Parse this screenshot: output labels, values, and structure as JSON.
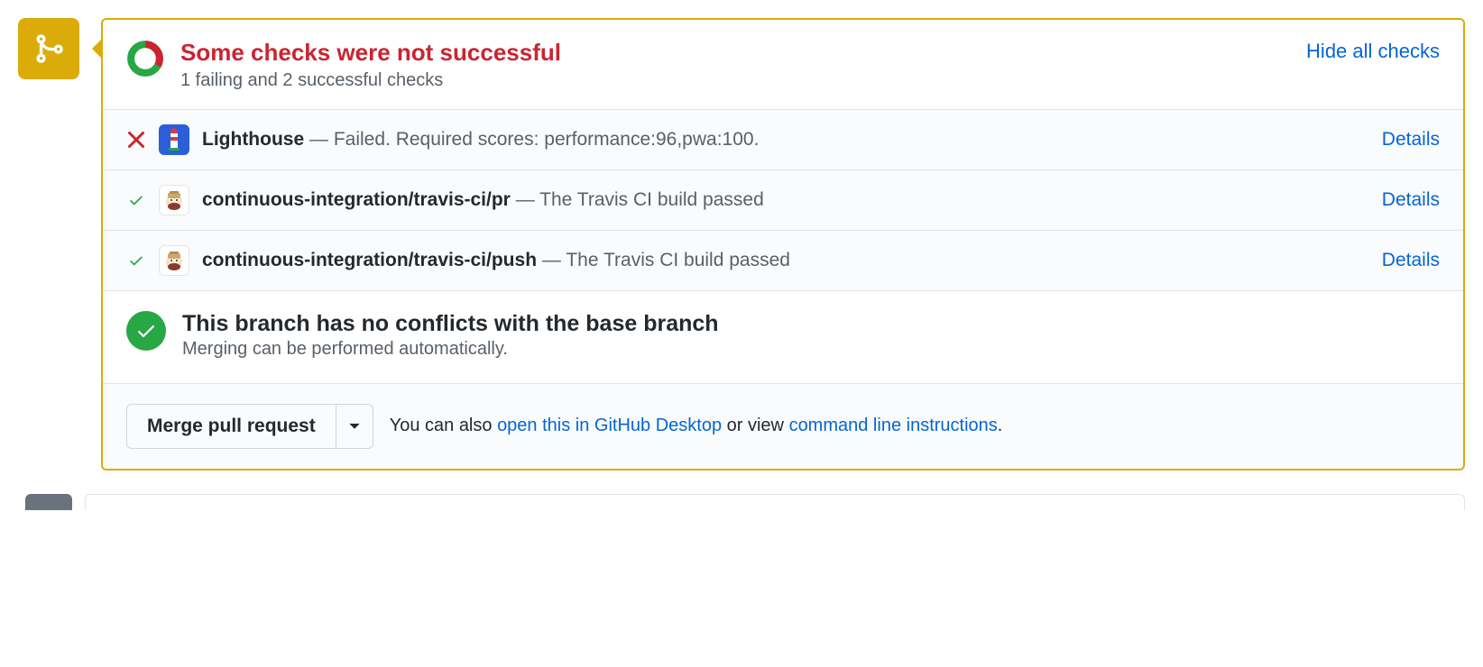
{
  "header": {
    "title": "Some checks were not successful",
    "subtitle": "1 failing and 2 successful checks",
    "hide_link": "Hide all checks"
  },
  "checks": [
    {
      "status": "fail",
      "avatar": "lighthouse",
      "name": "Lighthouse",
      "sep": " — ",
      "message": "Failed. Required scores: performance:96,pwa:100.",
      "details": "Details"
    },
    {
      "status": "pass",
      "avatar": "travis",
      "name": "continuous-integration/travis-ci/pr",
      "sep": " — ",
      "message": "The Travis CI build passed",
      "details": "Details"
    },
    {
      "status": "pass",
      "avatar": "travis",
      "name": "continuous-integration/travis-ci/push",
      "sep": " — ",
      "message": "The Travis CI build passed",
      "details": "Details"
    }
  ],
  "conflict": {
    "title": "This branch has no conflicts with the base branch",
    "subtitle": "Merging can be performed automatically."
  },
  "footer": {
    "merge_button": "Merge pull request",
    "text_prefix": "You can also ",
    "link_desktop": "open this in GitHub Desktop",
    "text_mid": " or view ",
    "link_cli": "command line instructions",
    "text_suffix": "."
  },
  "colors": {
    "warning": "#dbab09",
    "danger": "#cb2431",
    "success": "#28a745",
    "link": "#0366d6"
  }
}
